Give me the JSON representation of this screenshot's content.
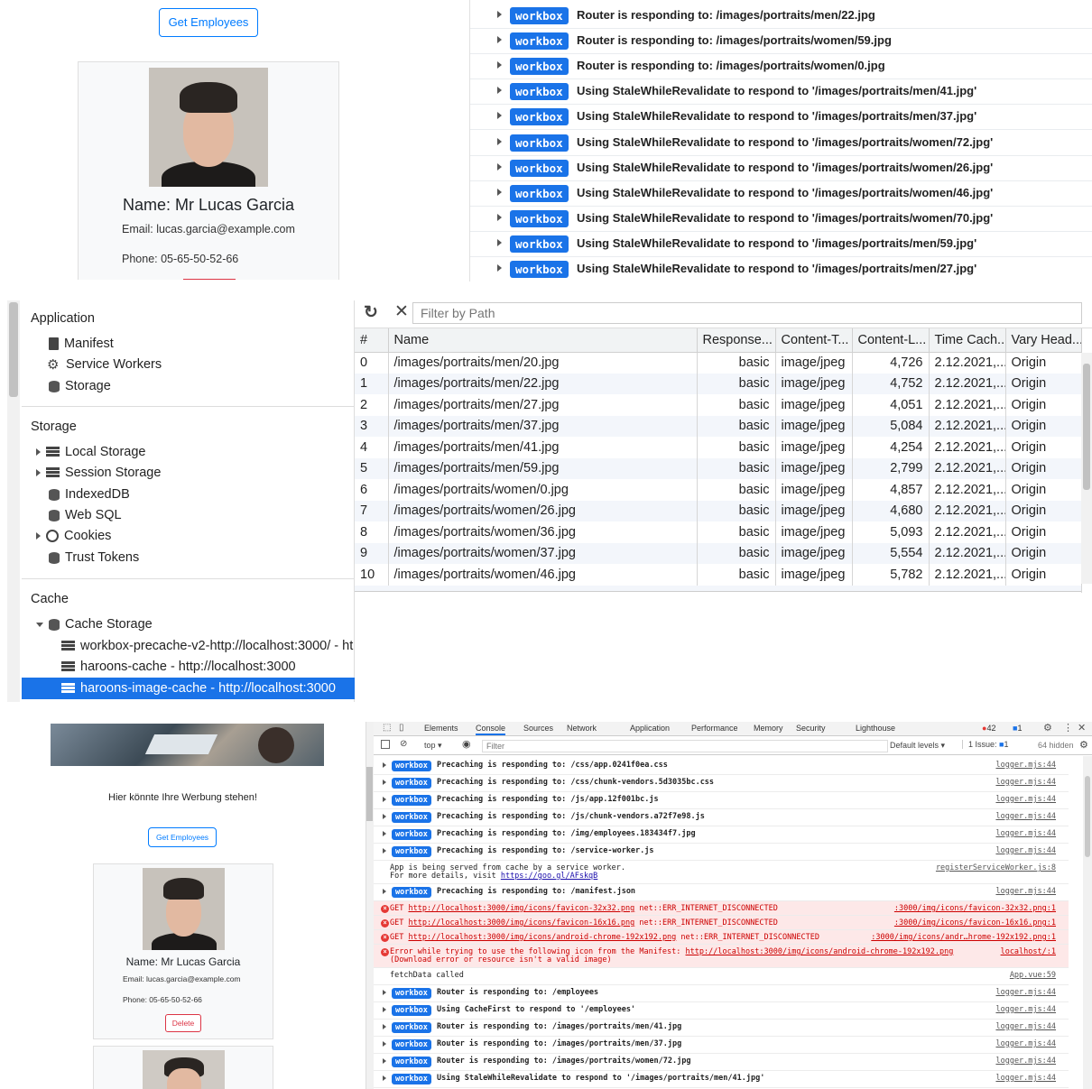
{
  "top_left": {
    "get_employees": "Get Employees",
    "name": "Name: Mr Lucas Garcia",
    "email": "Email: lucas.garcia@example.com",
    "phone": "Phone: 05-65-50-52-66"
  },
  "top_console": {
    "badge": "workbox",
    "rows": [
      "Router is responding to: /images/portraits/men/22.jpg",
      "Router is responding to: /images/portraits/women/59.jpg",
      "Router is responding to: /images/portraits/women/0.jpg",
      "Using StaleWhileRevalidate to respond to '/images/portraits/men/41.jpg'",
      "Using StaleWhileRevalidate to respond to '/images/portraits/men/37.jpg'",
      "Using StaleWhileRevalidate to respond to '/images/portraits/women/72.jpg'",
      "Using StaleWhileRevalidate to respond to '/images/portraits/women/26.jpg'",
      "Using StaleWhileRevalidate to respond to '/images/portraits/women/46.jpg'",
      "Using StaleWhileRevalidate to respond to '/images/portraits/women/70.jpg'",
      "Using StaleWhileRevalidate to respond to '/images/portraits/men/59.jpg'",
      "Using StaleWhileRevalidate to respond to '/images/portraits/men/27.jpg'"
    ]
  },
  "app_sidebar": {
    "application_title": "Application",
    "manifest": "Manifest",
    "service_workers": "Service Workers",
    "storage_item": "Storage",
    "storage_title": "Storage",
    "local_storage": "Local Storage",
    "session_storage": "Session Storage",
    "indexeddb": "IndexedDB",
    "web_sql": "Web SQL",
    "cookies": "Cookies",
    "trust_tokens": "Trust Tokens",
    "cache_title": "Cache",
    "cache_storage": "Cache Storage",
    "cache_entries": [
      "workbox-precache-v2-http://localhost:3000/ - ht",
      "haroons-cache - http://localhost:3000",
      "haroons-image-cache - http://localhost:3000"
    ]
  },
  "cache_table": {
    "filter_placeholder": "Filter by Path",
    "headers": [
      "#",
      "Name",
      "Response...",
      "Content-T...",
      "Content-L...",
      "Time Cach...",
      "Vary Head..."
    ],
    "rows": [
      [
        "0",
        "/images/portraits/men/20.jpg",
        "basic",
        "image/jpeg",
        "4,726",
        "2.12.2021,...",
        "Origin"
      ],
      [
        "1",
        "/images/portraits/men/22.jpg",
        "basic",
        "image/jpeg",
        "4,752",
        "2.12.2021,...",
        "Origin"
      ],
      [
        "2",
        "/images/portraits/men/27.jpg",
        "basic",
        "image/jpeg",
        "4,051",
        "2.12.2021,...",
        "Origin"
      ],
      [
        "3",
        "/images/portraits/men/37.jpg",
        "basic",
        "image/jpeg",
        "5,084",
        "2.12.2021,...",
        "Origin"
      ],
      [
        "4",
        "/images/portraits/men/41.jpg",
        "basic",
        "image/jpeg",
        "4,254",
        "2.12.2021,...",
        "Origin"
      ],
      [
        "5",
        "/images/portraits/men/59.jpg",
        "basic",
        "image/jpeg",
        "2,799",
        "2.12.2021,...",
        "Origin"
      ],
      [
        "6",
        "/images/portraits/women/0.jpg",
        "basic",
        "image/jpeg",
        "4,857",
        "2.12.2021,...",
        "Origin"
      ],
      [
        "7",
        "/images/portraits/women/26.jpg",
        "basic",
        "image/jpeg",
        "4,680",
        "2.12.2021,...",
        "Origin"
      ],
      [
        "8",
        "/images/portraits/women/36.jpg",
        "basic",
        "image/jpeg",
        "5,093",
        "2.12.2021,...",
        "Origin"
      ],
      [
        "9",
        "/images/portraits/women/37.jpg",
        "basic",
        "image/jpeg",
        "5,554",
        "2.12.2021,...",
        "Origin"
      ],
      [
        "10",
        "/images/portraits/women/46.jpg",
        "basic",
        "image/jpeg",
        "5,782",
        "2.12.2021,...",
        "Origin"
      ]
    ]
  },
  "bottom_left": {
    "ad_text": "Hier könnte Ihre Werbung stehen!",
    "get_employees": "Get Employees",
    "name": "Name: Mr Lucas Garcia",
    "email": "Email: lucas.garcia@example.com",
    "phone": "Phone: 05-65-50-52-66",
    "delete": "Delete"
  },
  "devtools": {
    "tabs": [
      "Elements",
      "Console",
      "Sources",
      "Network",
      "Application",
      "Performance",
      "Memory",
      "Security",
      "Lighthouse"
    ],
    "active_tab": "Console",
    "error_count": "42",
    "message_count": "1",
    "context": "top",
    "filter_placeholder": "Filter",
    "levels": "Default levels",
    "issues": "1 Issue:",
    "issues_count": "1",
    "hidden": "64 hidden",
    "badge": "workbox",
    "rows": [
      {
        "type": "wb",
        "msg": "Precaching is responding to: /css/app.0241f0ea.css",
        "src": "logger.mjs:44"
      },
      {
        "type": "wb",
        "msg": "Precaching is responding to: /css/chunk-vendors.5d3035bc.css",
        "src": "logger.mjs:44"
      },
      {
        "type": "wb",
        "msg": "Precaching is responding to: /js/app.12f001bc.js",
        "src": "logger.mjs:44"
      },
      {
        "type": "wb",
        "msg": "Precaching is responding to: /js/chunk-vendors.a72f7e98.js",
        "src": "logger.mjs:44"
      },
      {
        "type": "wb",
        "msg": "Precaching is responding to: /img/employees.183434f7.jpg",
        "src": "logger.mjs:44"
      },
      {
        "type": "wb",
        "msg": "Precaching is responding to: /service-worker.js",
        "src": "logger.mjs:44"
      },
      {
        "type": "info",
        "msg": "App is being served from cache by a service worker.",
        "msg2": "For more details, visit ",
        "link": "https://goo.gl/AFskqB",
        "src": "registerServiceWorker.js:8"
      },
      {
        "type": "wb",
        "msg": "Precaching is responding to: /manifest.json",
        "src": "logger.mjs:44"
      },
      {
        "type": "err",
        "method": "GET",
        "link": "http://localhost:3000/img/icons/favicon-32x32.png",
        "msg": "net::ERR_INTERNET_DISCONNECTED",
        "src": ":3000/img/icons/favicon-32x32.png:1"
      },
      {
        "type": "err",
        "method": "GET",
        "link": "http://localhost:3000/img/icons/favicon-16x16.png",
        "msg": "net::ERR_INTERNET_DISCONNECTED",
        "src": ":3000/img/icons/favicon-16x16.png:1"
      },
      {
        "type": "err",
        "method": "GET",
        "link": "http://localhost:3000/img/icons/android-chrome-192x192.png",
        "msg": "net::ERR_INTERNET_DISCONNECTED",
        "src": ":3000/img/icons/andr…hrome-192x192.png:1"
      },
      {
        "type": "err2",
        "msg": "Error while trying to use the following icon from the Manifest: ",
        "link": "http://localhost:3000/img/icons/android-chrome-192x192.png",
        "msg2": "(Download error or resource isn't a valid image)",
        "src": "localhost/:1"
      },
      {
        "type": "plain",
        "msg": "fetchData called",
        "src": "App.vue:59"
      },
      {
        "type": "wb",
        "msg": "Router is responding to: /employees",
        "src": "logger.mjs:44"
      },
      {
        "type": "wb",
        "msg": "Using CacheFirst to respond to '/employees'",
        "src": "logger.mjs:44"
      },
      {
        "type": "wb",
        "msg": "Router is responding to: /images/portraits/men/41.jpg",
        "src": "logger.mjs:44"
      },
      {
        "type": "wb",
        "msg": "Router is responding to: /images/portraits/men/37.jpg",
        "src": "logger.mjs:44"
      },
      {
        "type": "wb",
        "msg": "Router is responding to: /images/portraits/women/72.jpg",
        "src": "logger.mjs:44"
      },
      {
        "type": "wb",
        "msg": "Using StaleWhileRevalidate to respond to '/images/portraits/men/41.jpg'",
        "src": "logger.mjs:44"
      }
    ]
  }
}
